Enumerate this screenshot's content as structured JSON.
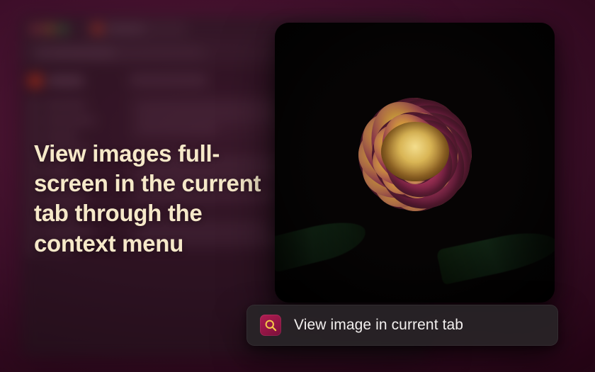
{
  "headline": "View images full-screen in the current tab through the context menu",
  "context_menu": {
    "icon_name": "magnifier-icon",
    "label": "View image in current tab"
  },
  "colors": {
    "headline_text": "#f6e9c9",
    "menu_bg": "rgba(40,36,39,0.92)",
    "menu_text": "#f3f0ef",
    "icon_bg_start": "#b11d52",
    "icon_bg_end": "#7a0f3a",
    "icon_glyph": "#f6c948"
  }
}
